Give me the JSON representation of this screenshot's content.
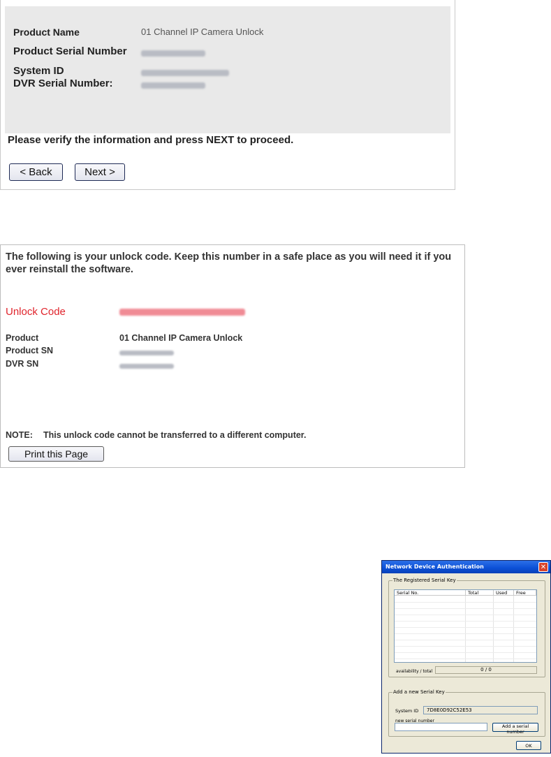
{
  "panel1": {
    "rows": [
      {
        "label": "Product Name",
        "value": "01 Channel IP Camera Unlock"
      },
      {
        "label": "Product Serial Number",
        "value": ""
      },
      {
        "label": "System ID",
        "value": ""
      },
      {
        "label": "DVR Serial Number:",
        "value": ""
      }
    ],
    "verify_text": "Please verify the information and press NEXT to proceed.",
    "back_label": "< Back",
    "next_label": "Next >"
  },
  "panel2": {
    "intro": "The following is your unlock code. Keep this number in a safe place as you will need it if you ever reinstall the software.",
    "unlock_label": "Unlock Code",
    "details": [
      {
        "label": "Product",
        "value": "01 Channel IP Camera Unlock"
      },
      {
        "label": "Product SN",
        "value": ""
      },
      {
        "label": "DVR SN",
        "value": ""
      }
    ],
    "note_label": "NOTE:",
    "note_text": "This unlock code cannot be transferred to a different computer.",
    "print_label": "Print this Page",
    "accent_color": "#e0242c"
  },
  "dialog": {
    "title": "Network Device Authentication",
    "close_glyph": "✕",
    "registered_group": "The Registered Serial Key",
    "columns": [
      "Serial No.",
      "Total",
      "Used",
      "Free"
    ],
    "availability_label": "availability / total",
    "availability_value": "0 / 0",
    "add_group": "Add a new Serial Key",
    "system_id_label": "System ID",
    "system_id_value": "7D8E0D92C52E53",
    "new_serial_label": "new serial number",
    "new_serial_value": "",
    "add_button": "Add a serial number",
    "ok_button": "OK"
  }
}
